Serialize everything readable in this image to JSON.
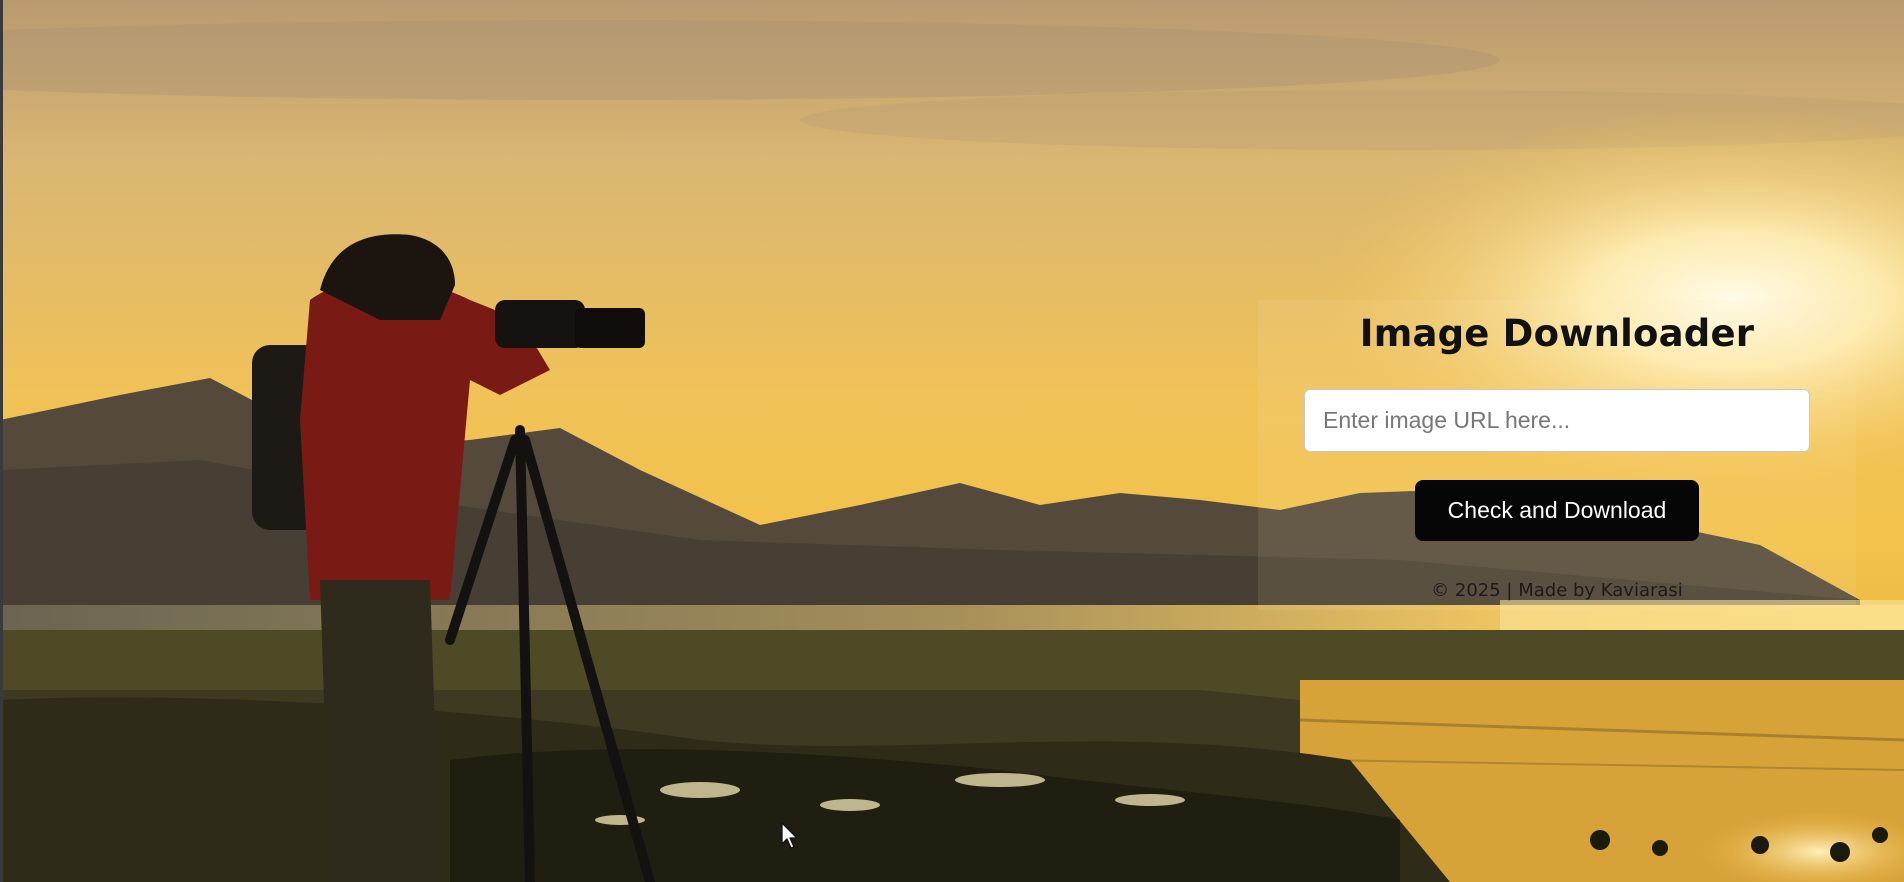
{
  "app": {
    "title": "Image Downloader"
  },
  "form": {
    "url_placeholder": "Enter image URL here...",
    "url_value": "",
    "submit_label": "Check and Download"
  },
  "footer": {
    "text": "© 2025 | Made by Kaviarasi"
  },
  "icons": {
    "cursor": "mouse-pointer-icon"
  },
  "colors": {
    "button_bg": "#060606",
    "button_text": "#ffffff",
    "title_text": "#111111"
  }
}
